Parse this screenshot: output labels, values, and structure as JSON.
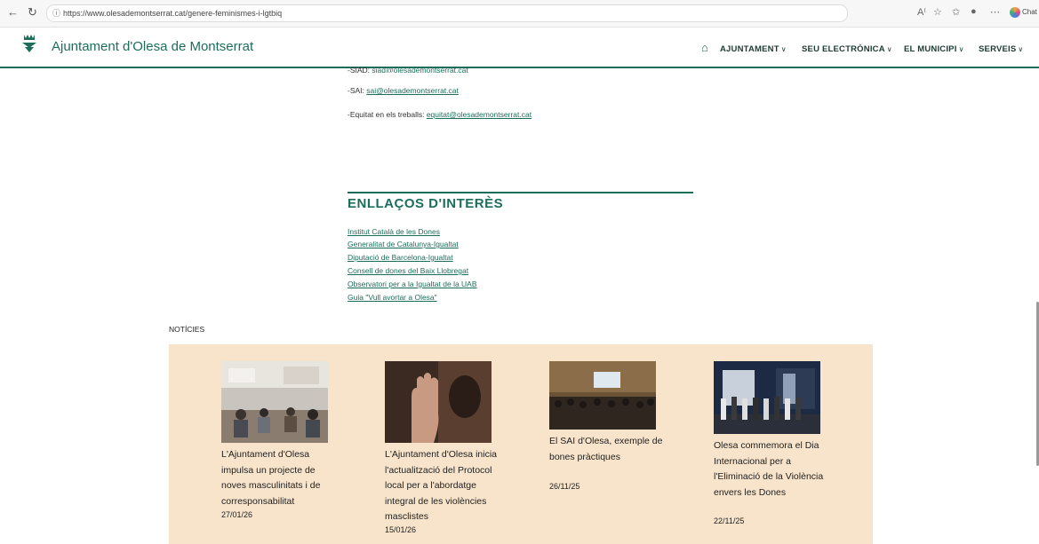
{
  "browser": {
    "url": "https://www.olesademontserrat.cat/genere-feminismes-i-lgtbiq",
    "chat_label": "Chat"
  },
  "header": {
    "site_name": "Ajuntament d'Olesa de Montserrat",
    "menu": [
      {
        "label": "AJUNTAMENT"
      },
      {
        "label": "SEU ELECTRÒNICA"
      },
      {
        "label": "EL MUNICIPI"
      },
      {
        "label": "SERVEIS"
      }
    ]
  },
  "contacts": {
    "siad_prefix": "-SIAD: ",
    "siad_email": "siad@olesademontserrat.cat",
    "sai_prefix": "-SAI: ",
    "sai_email": "sai@olesademontserrat.cat",
    "equitat_prefix": "-Equitat en els treballs: ",
    "equitat_email": "equitat@olesademontserrat.cat"
  },
  "links_section": {
    "title": "ENLLAÇOS D'INTERÈS",
    "links": [
      "Institut Català de les Dones",
      "Generalitat de Catalunya-Igualtat",
      "Diputació de Barcelona-Igualtat",
      "Consell de dones del Baix Llobregat",
      "Observatori per a la Igualtat de la UAB",
      "Guia \"Vull avortar a Olesa\""
    ]
  },
  "news": {
    "heading": "NOTÍCIES",
    "items": [
      {
        "title": "L'Ajuntament d'Olesa impulsa un projecte de noves masculinitats i de corresponsabilitat",
        "date": "27/01/26",
        "image": "meeting-room-photo"
      },
      {
        "title": "L'Ajuntament d'Olesa inicia l'actualització del Protocol local per a l'abordatge integral de les violències masclistes",
        "date": "15/01/26",
        "image": "raised-hand-photo"
      },
      {
        "title": "El SAI d'Olesa, exemple de bones pràctiques",
        "date": "26/11/25",
        "image": "auditorium-photo"
      },
      {
        "title": "Olesa commemora el Dia Internacional per a l'Eliminació de la Violència envers les Dones",
        "date": "22/11/25",
        "image": "night-gathering-photo"
      }
    ]
  },
  "colors": {
    "brand_green": "#1c6e5b",
    "news_background": "#f8e4cb"
  }
}
